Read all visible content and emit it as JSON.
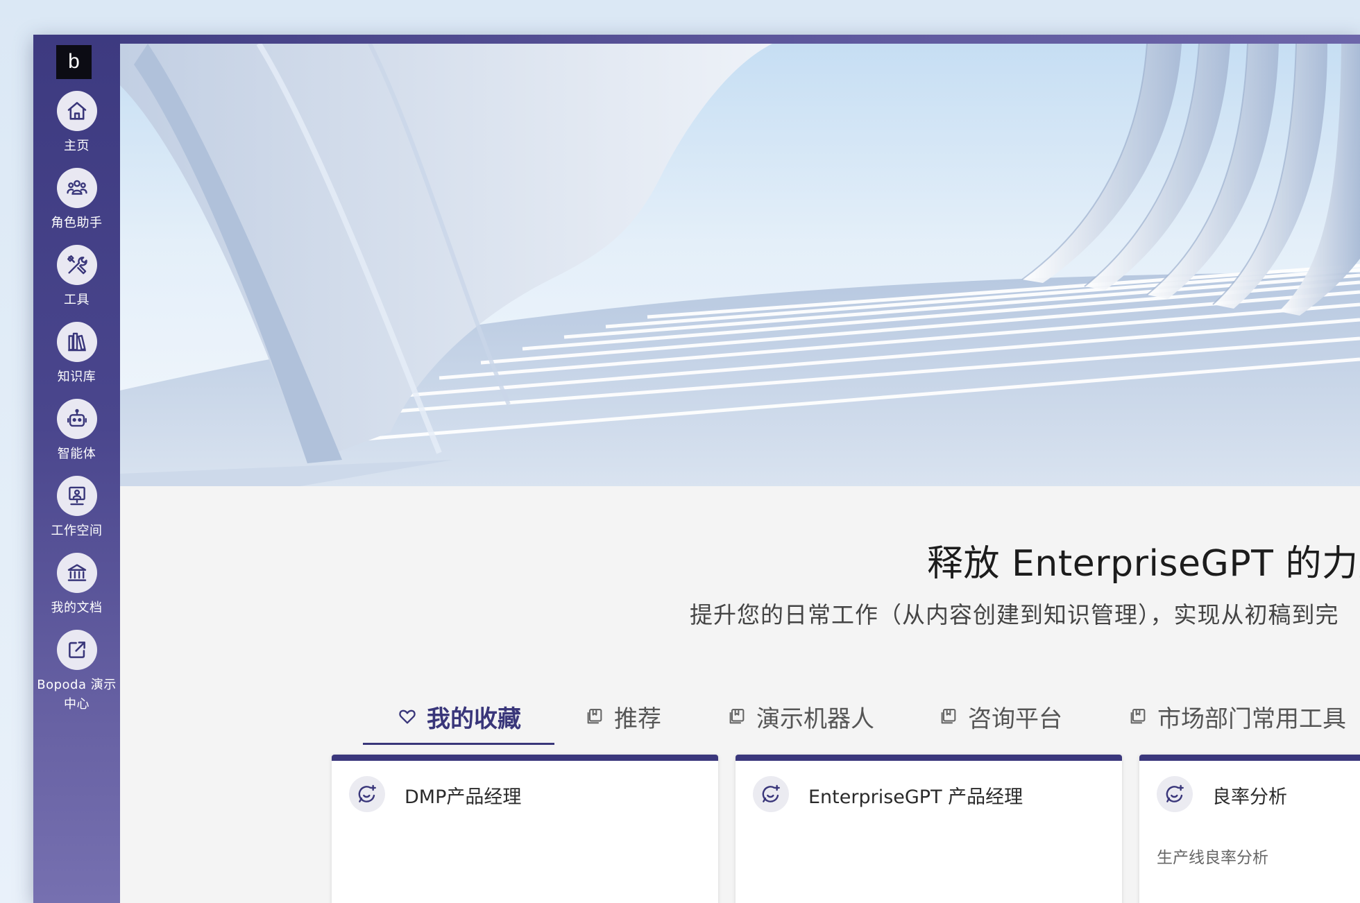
{
  "colors": {
    "sidebar_top": "#3d3a80",
    "sidebar_bottom": "#7670b0",
    "accent": "#39367a",
    "page_background": "#f4f4f4",
    "card_background": "#ffffff"
  },
  "logo": {
    "text": "b"
  },
  "sidebar": {
    "items": [
      {
        "label": "主页",
        "icon": "home-icon"
      },
      {
        "label": "角色助手",
        "icon": "team-icon"
      },
      {
        "label": "工具",
        "icon": "tools-icon"
      },
      {
        "label": "知识库",
        "icon": "library-icon"
      },
      {
        "label": "智能体",
        "icon": "robot-icon"
      },
      {
        "label": "工作空间",
        "icon": "workspace-icon"
      },
      {
        "label": "我的文档",
        "icon": "bank-icon"
      },
      {
        "label": "Bopoda 演示中心",
        "icon": "external-link-icon"
      }
    ]
  },
  "hero": {
    "image": "white-architectural-curves-image"
  },
  "main": {
    "headline": "释放 EnterpriseGPT 的力量",
    "subheadline": "提升您的日常工作（从内容创建到知识管理），实现从初稿到完"
  },
  "tabs": [
    {
      "label": "我的收藏",
      "icon": "heart-icon",
      "active": true
    },
    {
      "label": "推荐",
      "icon": "collection-icon",
      "active": false
    },
    {
      "label": "演示机器人",
      "icon": "collection-icon",
      "active": false
    },
    {
      "label": "咨询平台",
      "icon": "collection-icon",
      "active": false
    },
    {
      "label": "市场部门常用工具",
      "icon": "collection-icon",
      "active": false
    }
  ],
  "cards": [
    {
      "title": "DMP产品经理",
      "description": "",
      "icon": "ai-chat-icon"
    },
    {
      "title": "EnterpriseGPT 产品经理",
      "description": "",
      "icon": "ai-chat-icon"
    },
    {
      "title": "良率分析",
      "description": "生产线良率分析",
      "icon": "ai-chat-icon"
    }
  ]
}
